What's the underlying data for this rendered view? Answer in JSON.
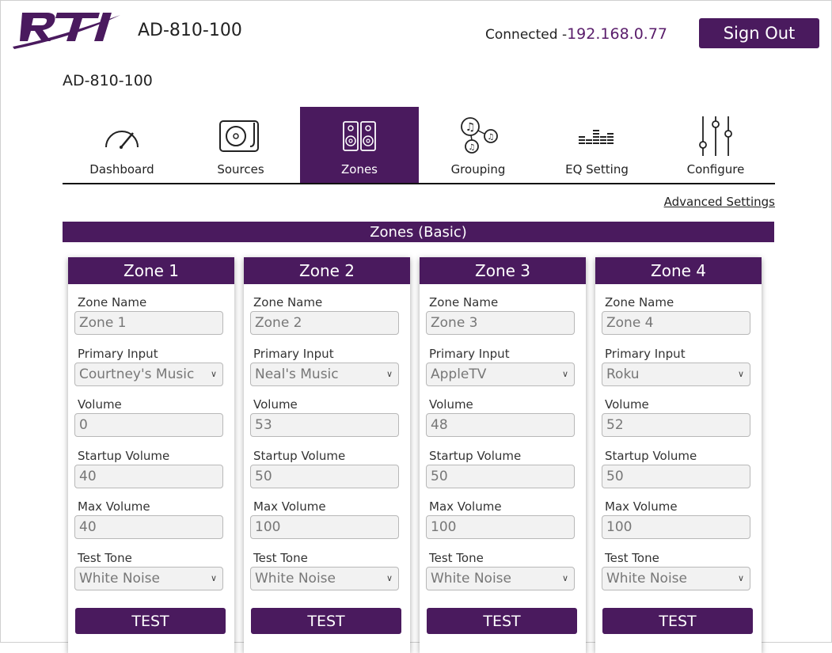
{
  "header": {
    "device_name": "AD-810-100",
    "connection_prefix": "Connected -",
    "ip": "192.168.0.77",
    "sign_out": "Sign Out"
  },
  "page": {
    "title": "AD-810-100",
    "advanced_link": "Advanced Settings",
    "section_title": "Zones (Basic)"
  },
  "tabs": [
    {
      "label": "Dashboard",
      "icon": "gauge-icon"
    },
    {
      "label": "Sources",
      "icon": "turntable-icon"
    },
    {
      "label": "Zones",
      "icon": "speakers-icon",
      "active": true
    },
    {
      "label": "Grouping",
      "icon": "music-notes-group-icon"
    },
    {
      "label": "EQ Setting",
      "icon": "equalizer-bars-icon"
    },
    {
      "label": "Configure",
      "icon": "sliders-icon"
    }
  ],
  "labels": {
    "zone_name": "Zone Name",
    "primary_input": "Primary Input",
    "volume": "Volume",
    "startup_volume": "Startup Volume",
    "max_volume": "Max Volume",
    "test_tone": "Test Tone",
    "test_button": "TEST"
  },
  "zones": [
    {
      "title": "Zone 1",
      "name": "Zone 1",
      "input": "Courtney's Music",
      "volume": "0",
      "startup_volume": "40",
      "max_volume": "40",
      "test_tone": "White Noise"
    },
    {
      "title": "Zone 2",
      "name": "Zone 2",
      "input": "Neal's Music",
      "volume": "53",
      "startup_volume": "50",
      "max_volume": "100",
      "test_tone": "White Noise"
    },
    {
      "title": "Zone 3",
      "name": "Zone 3",
      "input": "AppleTV",
      "volume": "48",
      "startup_volume": "50",
      "max_volume": "100",
      "test_tone": "White Noise"
    },
    {
      "title": "Zone 4",
      "name": "Zone 4",
      "input": "Roku",
      "volume": "52",
      "startup_volume": "50",
      "max_volume": "100",
      "test_tone": "White Noise"
    }
  ],
  "colors": {
    "accent": "#4a1a5e",
    "ip_text": "#5a1d6b"
  }
}
